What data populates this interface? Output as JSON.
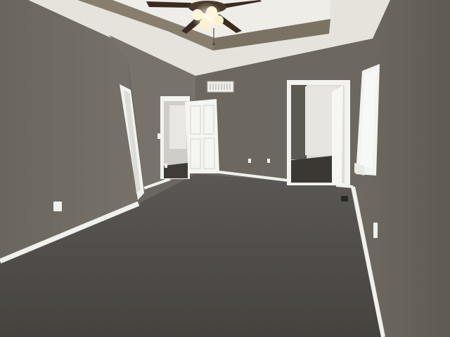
{
  "scene": {
    "type": "photo-interior-empty-bedroom",
    "colors": {
      "wall": "#6e6a62",
      "wall_light": "#7c786f",
      "wall_dark": "#5e5a53",
      "ceiling": "#e9e7e2",
      "tray_band": "#7d7566",
      "carpet": "#4f4c4a",
      "trim": "#f2f2ef",
      "door": "#f4f4f1",
      "hall_floor": "#3e3a36",
      "fan_blade": "#3a2a1f",
      "fan_light": "#fff6da"
    },
    "objects": [
      "ceiling-fan",
      "tray-ceiling",
      "air-vent",
      "open-door",
      "closet-doorway",
      "bathroom-doorway",
      "window",
      "electrical-outlet",
      "floor-vent",
      "light-switch",
      "carpet",
      "baseboard"
    ]
  }
}
